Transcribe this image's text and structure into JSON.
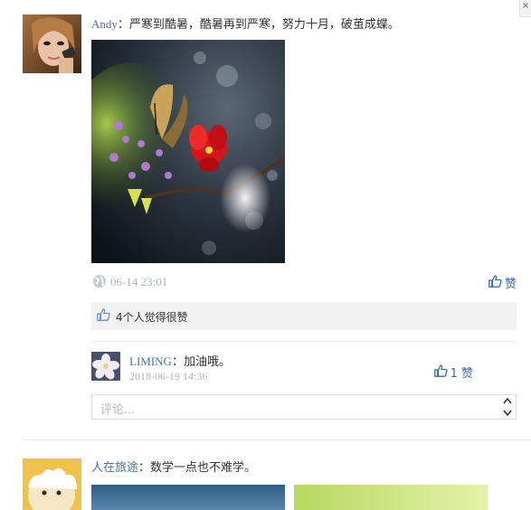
{
  "window": {
    "close_glyph": "×"
  },
  "posts": [
    {
      "author": "Andy",
      "separator": "：",
      "text": "严寒到酷暑，酷暑再到严寒，努力十月，破茧成蝶。",
      "time": "06-14 23:01",
      "like_label": "赞",
      "likes_text": "4个人觉得很赞",
      "comments": [
        {
          "author": "LIMING",
          "separator": "：",
          "text": "加油哦。",
          "time": "2018-06-19 14:36",
          "likes": "1 赞"
        }
      ],
      "comment_placeholder": "评论..."
    },
    {
      "author": "人在旅途",
      "separator": "：",
      "text": "数学一点也不难学。"
    }
  ],
  "icons": {
    "globe": "globe-icon",
    "thumb": "thumb-up-icon",
    "scroll": "scroll-arrows-icon"
  },
  "colors": {
    "link": "#4b6ea8",
    "muted": "#aeb4bc",
    "accent": "#3b6aa8",
    "panel": "#f2f2f2"
  }
}
